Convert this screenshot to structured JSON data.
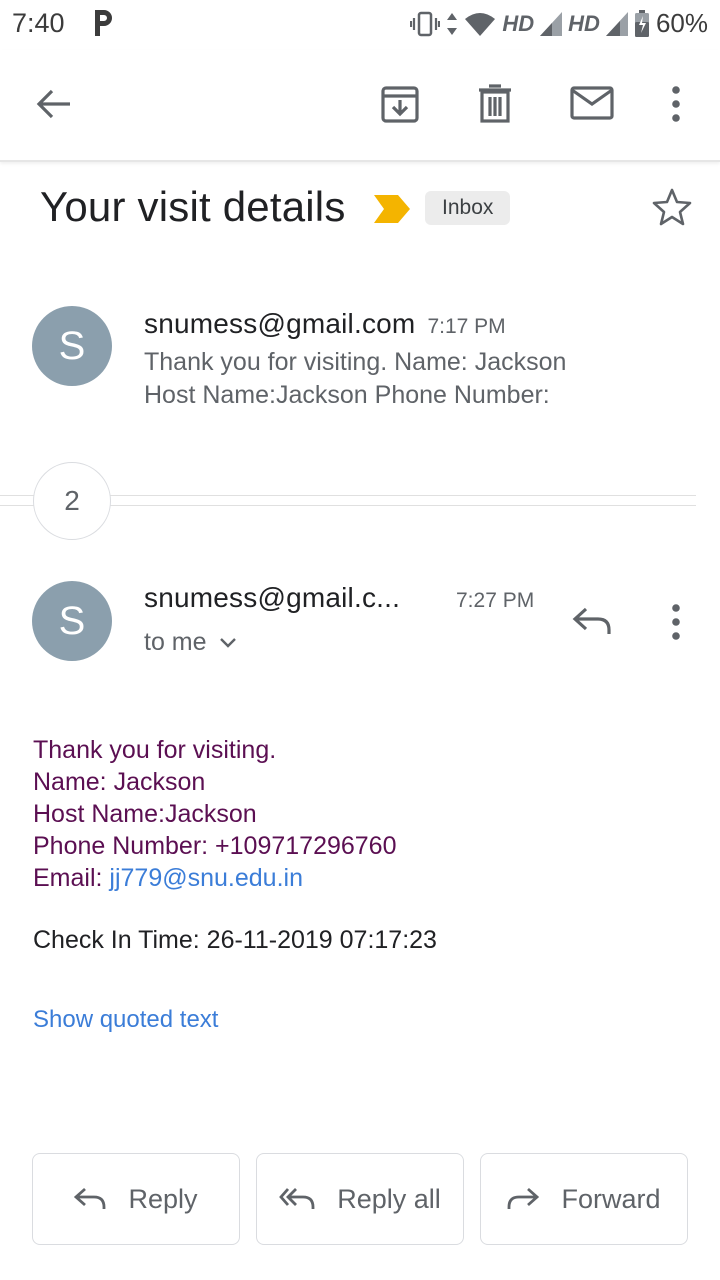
{
  "status_bar": {
    "time": "7:40",
    "hd1": "HD",
    "hd2": "HD",
    "battery": "60%"
  },
  "subject": {
    "title": "Your visit details",
    "label": "Inbox"
  },
  "thread": {
    "message1": {
      "avatar_letter": "S",
      "sender": "snumess@gmail.com",
      "time": "7:17 PM",
      "snippet_line1": "Thank you for visiting. Name: Jackson",
      "snippet_line2": "Host Name:Jackson Phone Number:"
    },
    "collapsed_count": "2",
    "message2": {
      "avatar_letter": "S",
      "sender": "snumess@gmail.c...",
      "time": "7:27 PM",
      "recipient": "to me",
      "body": {
        "line1": "Thank you for visiting.",
        "line2": "Name: Jackson",
        "line3": "Host Name:Jackson",
        "line4": "Phone Number: +109717296760",
        "email_label": "Email: ",
        "email_link": "jj779@snu.edu.in",
        "checkin": "Check In Time: 26-11-2019 07:17:23"
      },
      "show_quoted": "Show quoted text"
    }
  },
  "actions": {
    "reply": "Reply",
    "reply_all": "Reply all",
    "forward": "Forward"
  },
  "colors": {
    "avatar": "#8b9fad",
    "body_text": "#5b0f52",
    "link": "#3b7dd8",
    "important": "#f4b400"
  }
}
